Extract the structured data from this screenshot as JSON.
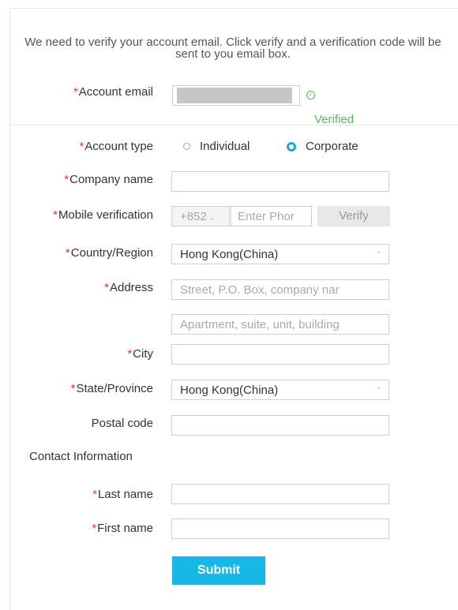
{
  "intro_text": "We need to verify your account email. Click verify and a verification code will be sent to you email box.",
  "required_mark": "*",
  "account_email": {
    "label": "Account email",
    "status": "Verified",
    "status_icon": "check-circle-icon",
    "status_color": "#5cb85c"
  },
  "account_type": {
    "label": "Account type",
    "options": [
      "Individual",
      "Corporate"
    ],
    "selected": "Corporate"
  },
  "company_name": {
    "label": "Company name",
    "value": ""
  },
  "mobile": {
    "label": "Mobile verification",
    "code": "+852",
    "placeholder": "Enter Phor",
    "verify_label": "Verify"
  },
  "country": {
    "label": "Country/Region",
    "value": "Hong Kong(China)"
  },
  "address": {
    "label": "Address",
    "placeholder1": "Street, P.O. Box, company nar",
    "placeholder2": "Apartment, suite, unit, building"
  },
  "city": {
    "label": "City"
  },
  "state": {
    "label": "State/Province",
    "value": "Hong Kong(China)"
  },
  "postal": {
    "label": "Postal code"
  },
  "contact_section": "Contact Information",
  "last_name": {
    "label": "Last name"
  },
  "first_name": {
    "label": "First name"
  },
  "submit_label": "Submit",
  "colors": {
    "accent": "#18b8e6",
    "required": "#e4393c",
    "success": "#5cb85c"
  }
}
